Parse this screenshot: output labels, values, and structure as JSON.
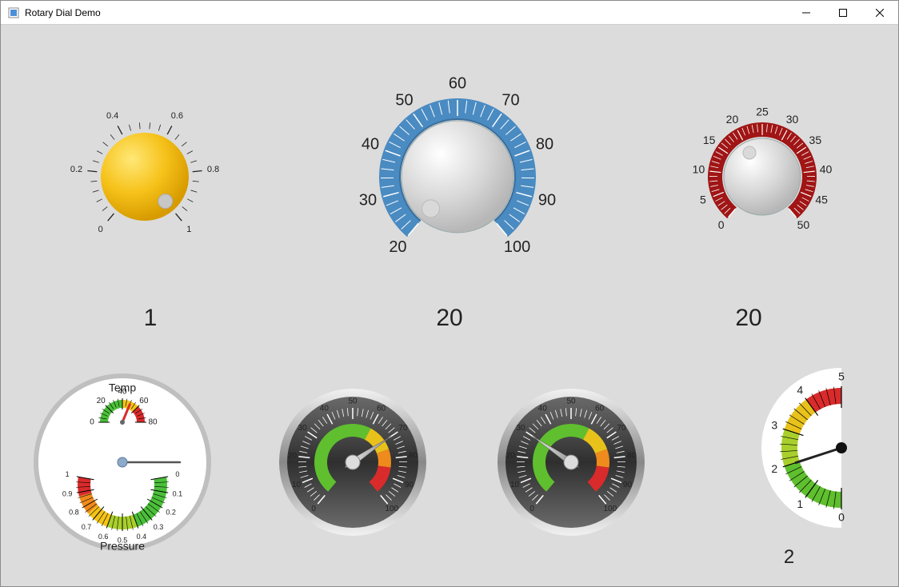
{
  "window": {
    "title": "Rotary Dial Demo"
  },
  "dial1": {
    "ticks": [
      "0",
      "0.2",
      "0.4",
      "0.6",
      "0.8",
      "1"
    ],
    "value_display": "1"
  },
  "dial2": {
    "ticks": [
      "20",
      "30",
      "40",
      "50",
      "60",
      "70",
      "80",
      "90",
      "100"
    ],
    "value_display": "20"
  },
  "dial3": {
    "ticks": [
      "0",
      "5",
      "10",
      "15",
      "20",
      "25",
      "30",
      "35",
      "40",
      "45",
      "50"
    ],
    "value_display": "20"
  },
  "dual_gauge": {
    "top_label": "Temp",
    "top_ticks": [
      "0",
      "20",
      "40",
      "60",
      "80"
    ],
    "bottom_label": "Pressure",
    "bottom_ticks": [
      "0",
      "0.1",
      "0.2",
      "0.3",
      "0.4",
      "0.5",
      "0.6",
      "0.7",
      "0.8",
      "0.9",
      "1"
    ]
  },
  "speedo1": {
    "ticks": [
      "0",
      "10",
      "20",
      "30",
      "40",
      "50",
      "60",
      "70",
      "80",
      "90",
      "100"
    ]
  },
  "speedo2": {
    "ticks": [
      "0",
      "10",
      "20",
      "30",
      "40",
      "50",
      "60",
      "70",
      "80",
      "90",
      "100"
    ]
  },
  "wedge": {
    "ticks": [
      "0",
      "1",
      "2",
      "3",
      "4",
      "5"
    ],
    "value_display": "2"
  },
  "chart_data": [
    {
      "type": "gauge",
      "name": "dial1",
      "range": [
        0,
        1
      ],
      "step": 0.2,
      "value": 1
    },
    {
      "type": "gauge",
      "name": "dial2",
      "range": [
        20,
        100
      ],
      "step": 10,
      "value": 20
    },
    {
      "type": "gauge",
      "name": "dial3",
      "range": [
        0,
        50
      ],
      "step": 5,
      "value": 20
    },
    {
      "type": "gauge",
      "name": "temp",
      "range": [
        0,
        80
      ],
      "step": 20,
      "value": 50,
      "zones": [
        [
          0,
          40,
          "green"
        ],
        [
          40,
          60,
          "yellow"
        ],
        [
          60,
          80,
          "red"
        ]
      ]
    },
    {
      "type": "gauge",
      "name": "pressure",
      "range": [
        0,
        1
      ],
      "step": 0.1,
      "value": 0,
      "zones_reversed": true
    },
    {
      "type": "gauge",
      "name": "speedo1",
      "range": [
        0,
        100
      ],
      "step": 10,
      "value": 70,
      "zones": [
        [
          0,
          60,
          "green"
        ],
        [
          60,
          80,
          "yellow"
        ],
        [
          80,
          100,
          "red"
        ]
      ]
    },
    {
      "type": "gauge",
      "name": "speedo2",
      "range": [
        0,
        100
      ],
      "step": 10,
      "value": 30
    },
    {
      "type": "gauge",
      "name": "wedge",
      "range": [
        0,
        5
      ],
      "step": 1,
      "value": 2,
      "zones": [
        [
          0,
          2,
          "green"
        ],
        [
          2,
          3,
          "yellowgreen"
        ],
        [
          3,
          4,
          "yellow"
        ],
        [
          4,
          5,
          "red"
        ]
      ]
    }
  ]
}
